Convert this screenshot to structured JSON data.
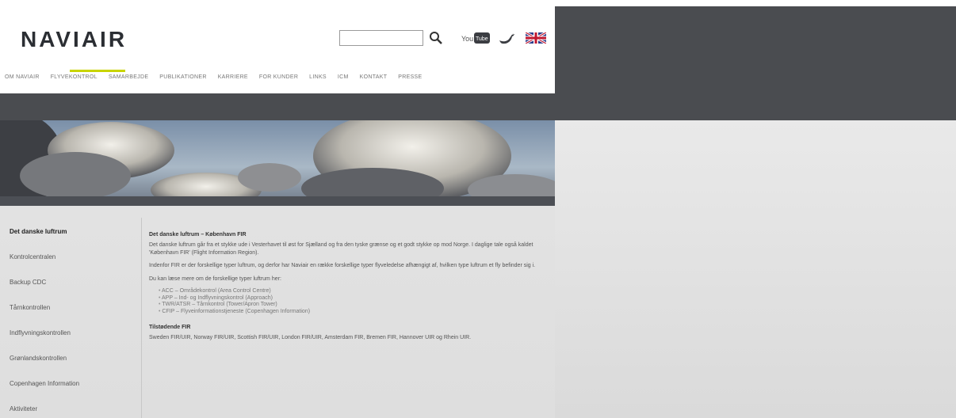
{
  "header": {
    "logo": "NAVIAIR",
    "search": {
      "placeholder": "",
      "value": ""
    },
    "youtube_label": "You Tube"
  },
  "nav": {
    "items": [
      "OM NAVIAIR",
      "FLYVEKONTROL",
      "SAMARBEJDE",
      "PUBLIKATIONER",
      "KARRIERE",
      "FOR KUNDER",
      "LINKS",
      "ICM",
      "KONTAKT",
      "PRESSE"
    ],
    "active_index": 1
  },
  "sidebar": {
    "items": [
      "Det danske luftrum",
      "Kontrolcentralen",
      "Backup CDC",
      "Tårnkontrollen",
      "Indflyvningskontrollen",
      "Grønlandskontrollen",
      "Copenhagen Information",
      "Aktiviteter"
    ],
    "active_index": 0
  },
  "content": {
    "title": "Det danske luftrum – København FIR",
    "para1": "Det danske luftrum går fra et stykke ude i Vesterhavet til øst for Sjælland og fra den tyske grænse og et godt stykke op mod Norge. I daglige tale også kaldet 'København FIR' (Flight Information Region).",
    "para2": "Indenfor FIR er der forskellige typer luftrum, og derfor har Naviair en række forskellige typer flyveledelse afhængigt af, hvilken type luftrum et fly befinder sig i.",
    "para3": "Du kan læse mere om de forskellige typer luftrum her:",
    "list": [
      "ACC – Områdekontrol (Area Control Centre)",
      "APP – Ind- og Indflyvningskontrol (Approach)",
      "TWR/ATSR – Tårnkontrol (Tower/Apron Tower)",
      "CFIP – Flyveinformationstjeneste (Copenhagen Information)"
    ],
    "title2": "Tilstødende FIR",
    "para4": "Sweden FIR/UIR, Norway FIR/UIR, Scottish FIR/UIR, London FIR/UIR, Amsterdam FIR, Bremen FIR, Hannover UIR og Rhein UIR."
  },
  "colors": {
    "accent": "#c8d400",
    "dark_band": "#4a4c50",
    "logo": "#2b2e33"
  }
}
